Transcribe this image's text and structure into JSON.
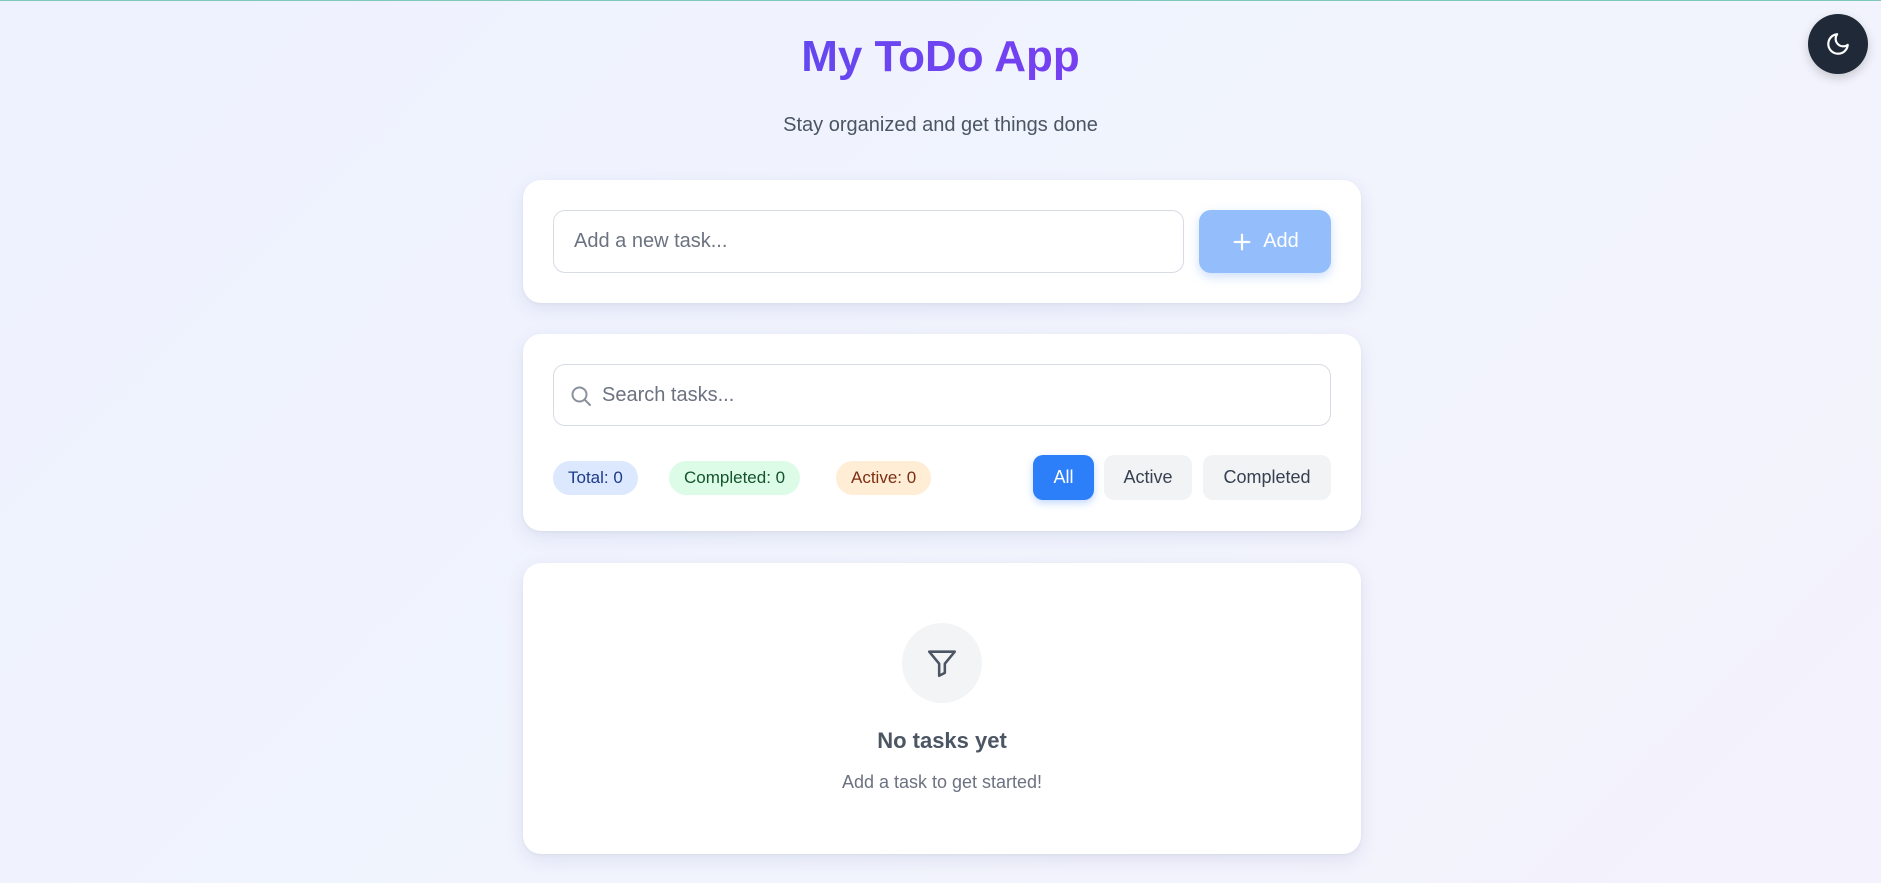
{
  "header": {
    "title": "My ToDo App",
    "subtitle": "Stay organized and get things done"
  },
  "theme_toggle": {
    "icon": "moon-icon"
  },
  "add_task": {
    "placeholder": "Add a new task...",
    "value": "",
    "button_label": "Add",
    "button_icon": "plus-icon"
  },
  "search": {
    "placeholder": "Search tasks...",
    "value": "",
    "icon": "search-icon"
  },
  "stats": {
    "total": "Total: 0",
    "completed": "Completed: 0",
    "active": "Active: 0"
  },
  "filters": {
    "selected": "All",
    "items": [
      "All",
      "Active",
      "Completed"
    ]
  },
  "empty_state": {
    "icon": "filter-icon",
    "title": "No tasks yet",
    "subtitle": "Add a task to get started!"
  },
  "colors": {
    "accent": "#2d7ff9",
    "add_button": "#93bdfb",
    "title_gradient_start": "#2f5cf0",
    "title_gradient_end": "#9b2ff0",
    "toggle_bg": "#1f2937"
  }
}
